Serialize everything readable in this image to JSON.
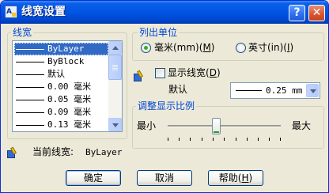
{
  "window": {
    "title": "线宽设置",
    "help_glyph": "?",
    "close_glyph": "✕"
  },
  "lineweights": {
    "group_title": "线宽",
    "items": [
      {
        "label": "ByLayer",
        "selected": true
      },
      {
        "label": "ByBlock",
        "selected": false
      },
      {
        "label": "默认",
        "selected": false
      },
      {
        "label": "0.00 毫米",
        "selected": false
      },
      {
        "label": "0.05 毫米",
        "selected": false
      },
      {
        "label": "0.09 毫米",
        "selected": false
      },
      {
        "label": "0.13 毫米",
        "selected": false
      }
    ]
  },
  "units": {
    "group_title": "列出单位",
    "millimeters": {
      "text": "毫米(mm)(",
      "key": "M",
      "tail": ")",
      "selected": true
    },
    "inches": {
      "text": "英寸(in)(",
      "key": "I",
      "tail": ")",
      "selected": false
    }
  },
  "display": {
    "checkbox": {
      "text": "显示线宽(",
      "key": "D",
      "tail": ")",
      "checked": false
    },
    "default_label": "默认",
    "default_value": "0.25 mm"
  },
  "scale": {
    "group_title": "调整显示比例",
    "min_label": "最小",
    "max_label": "最大",
    "level_fraction": 0.4
  },
  "current": {
    "label": "当前线宽:",
    "value": "ByLayer"
  },
  "buttons": {
    "ok": "确定",
    "cancel": "取消",
    "help": {
      "text": "帮助(",
      "key": "H",
      "tail": ")"
    }
  },
  "colors": {
    "title_bar": "#0054e3",
    "selection": "#316ac5",
    "group_label": "#0046d5",
    "dialog_bg": "#ece9d8"
  }
}
